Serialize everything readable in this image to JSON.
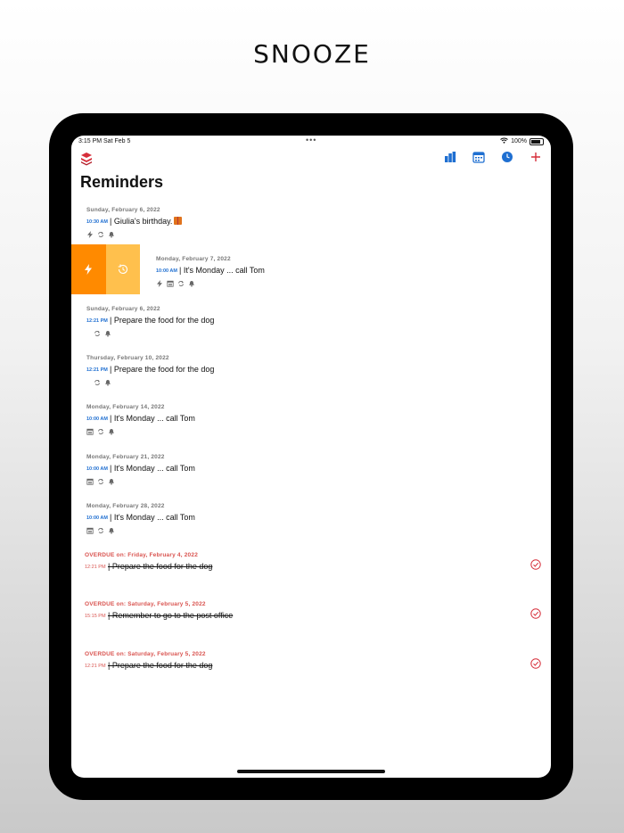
{
  "headline": "SNOOZE",
  "status": {
    "time": "3:15 PM   Sat Feb 5",
    "dots": "•••",
    "battery": "100%"
  },
  "page": {
    "title": "Reminders"
  },
  "colors": {
    "accent_blue": "#1f6fd1",
    "overdue_red": "#d9534f",
    "snooze_orange": "#ff8a00",
    "snooze_light": "#ffc04d"
  },
  "toolbar": {
    "icons": [
      "stats-icon",
      "calendar-icon",
      "clock-icon",
      "add-icon"
    ]
  },
  "swipe_actions": [
    {
      "icon": "lightning-icon"
    },
    {
      "icon": "snooze-clock-icon"
    }
  ],
  "reminders": [
    {
      "date": "Sunday, February 6, 2022",
      "time": "10:30 AM",
      "title": "| Giulia's birthday.",
      "icons": [
        "lightning-icon",
        "repeat-icon",
        "bell-icon"
      ]
    },
    {
      "date": "Monday, February 7, 2022",
      "time": "10:00 AM",
      "title": "| It's Monday ... call Tom",
      "icons": [
        "lightning-icon",
        "calendar-icon",
        "repeat-icon",
        "bell-icon"
      ]
    },
    {
      "date": "Sunday, February 6, 2022",
      "time": "12:21 PM",
      "title": "| Prepare the food for the dog",
      "icons": [
        "repeat-icon",
        "bell-icon"
      ]
    },
    {
      "date": "Thursday, February 10, 2022",
      "time": "12:21 PM",
      "title": "| Prepare the food for the dog",
      "icons": [
        "repeat-icon",
        "bell-icon"
      ]
    },
    {
      "date": "Monday, February 14, 2022",
      "time": "10:00 AM",
      "title": "| It's Monday ... call Tom",
      "icons": [
        "calendar-icon",
        "repeat-icon",
        "bell-icon"
      ]
    },
    {
      "date": "Monday, February 21, 2022",
      "time": "10:00 AM",
      "title": "| It's Monday ... call Tom",
      "icons": [
        "calendar-icon",
        "repeat-icon",
        "bell-icon"
      ]
    },
    {
      "date": "Monday, February 28, 2022",
      "time": "10:00 AM",
      "title": "| It's Monday ... call Tom",
      "icons": [
        "calendar-icon",
        "repeat-icon",
        "bell-icon"
      ]
    }
  ],
  "overdue": [
    {
      "date": "OVERDUE on:  Friday, February 4, 2022",
      "time": "12:21 PM",
      "title": "| Prepare the food for the dog"
    },
    {
      "date": "OVERDUE on:  Saturday, February 5, 2022",
      "time": "15:15 PM",
      "title": "| Remember to go to the post office"
    },
    {
      "date": "OVERDUE on:  Saturday, February 5, 2022",
      "time": "12:21 PM",
      "title": "| Prepare the food for the dog"
    }
  ]
}
